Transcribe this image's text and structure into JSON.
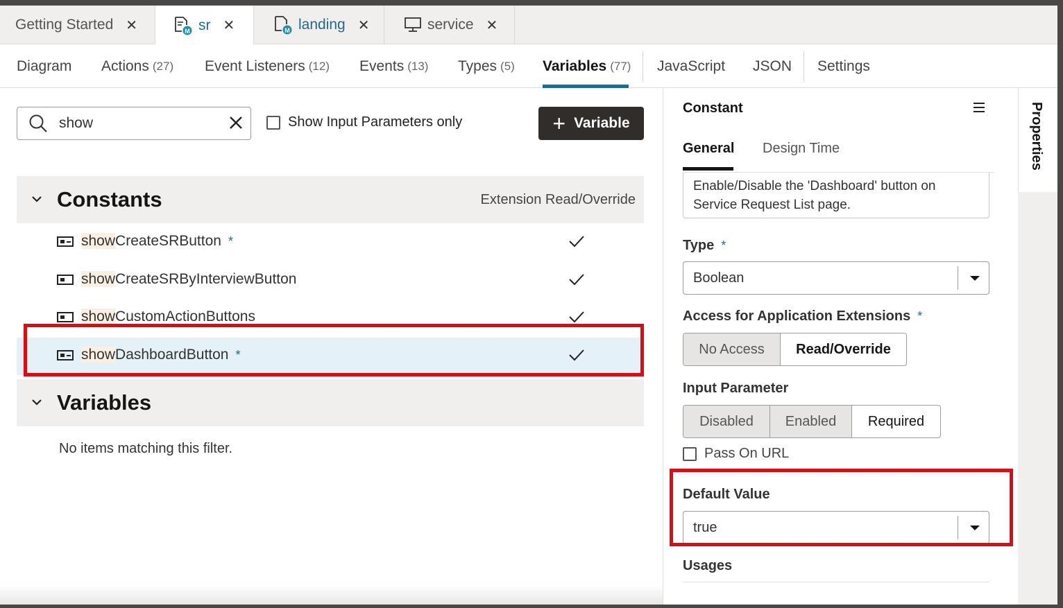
{
  "editor_tabs": [
    {
      "label": "Getting Started",
      "icon": "none"
    },
    {
      "label": "sr",
      "icon": "page-flow-icon"
    },
    {
      "label": "landing",
      "icon": "page-flow-icon"
    },
    {
      "label": "service",
      "icon": "monitor-icon"
    }
  ],
  "subnav": [
    {
      "label": "Diagram",
      "count": ""
    },
    {
      "label": "Actions",
      "count": "(27)"
    },
    {
      "label": "Event Listeners",
      "count": "(12)"
    },
    {
      "label": "Events",
      "count": "(13)"
    },
    {
      "label": "Types",
      "count": "(5)"
    },
    {
      "label": "Variables",
      "count": "(77)"
    },
    {
      "label": "JavaScript",
      "count": ""
    },
    {
      "label": "JSON",
      "count": ""
    },
    {
      "label": "Settings",
      "count": ""
    }
  ],
  "search": {
    "value": "show"
  },
  "filter_checkbox_label": "Show Input Parameters only",
  "add_variable_label": "Variable",
  "constants": {
    "title": "Constants",
    "column": "Extension Read/Override",
    "items": [
      {
        "match": "show",
        "rest": "CreateSRButton",
        "required": "*",
        "extension": true
      },
      {
        "match": "show",
        "rest": "CreateSRByInterviewButton",
        "required": "",
        "extension": true
      },
      {
        "match": "show",
        "rest": "CustomActionButtons",
        "required": "",
        "extension": true
      },
      {
        "match": "show",
        "rest": "DashboardButton",
        "required": "*",
        "extension": true,
        "selected": true
      }
    ]
  },
  "variables": {
    "title": "Variables",
    "empty": "No items matching this filter."
  },
  "properties": {
    "title": "Constant",
    "tabs": [
      "General",
      "Design Time"
    ],
    "description": "Enable/Disable the 'Dashboard' button on Service Request List page.",
    "type_label": "Type",
    "required_mark": "*",
    "type_value": "Boolean",
    "access_label": "Access for Application Extensions",
    "access_options": [
      "No Access",
      "Read/Override"
    ],
    "input_param_label": "Input Parameter",
    "input_param_options": [
      "Disabled",
      "Enabled",
      "Required"
    ],
    "pass_on_url": "Pass On URL",
    "default_label": "Default Value",
    "default_value": "true",
    "usages_label": "Usages"
  },
  "side_tab": "Properties",
  "colors": {
    "accent": "#1c6c8e",
    "highlight_red": "#e00a12",
    "button_dark": "#312d2a"
  }
}
